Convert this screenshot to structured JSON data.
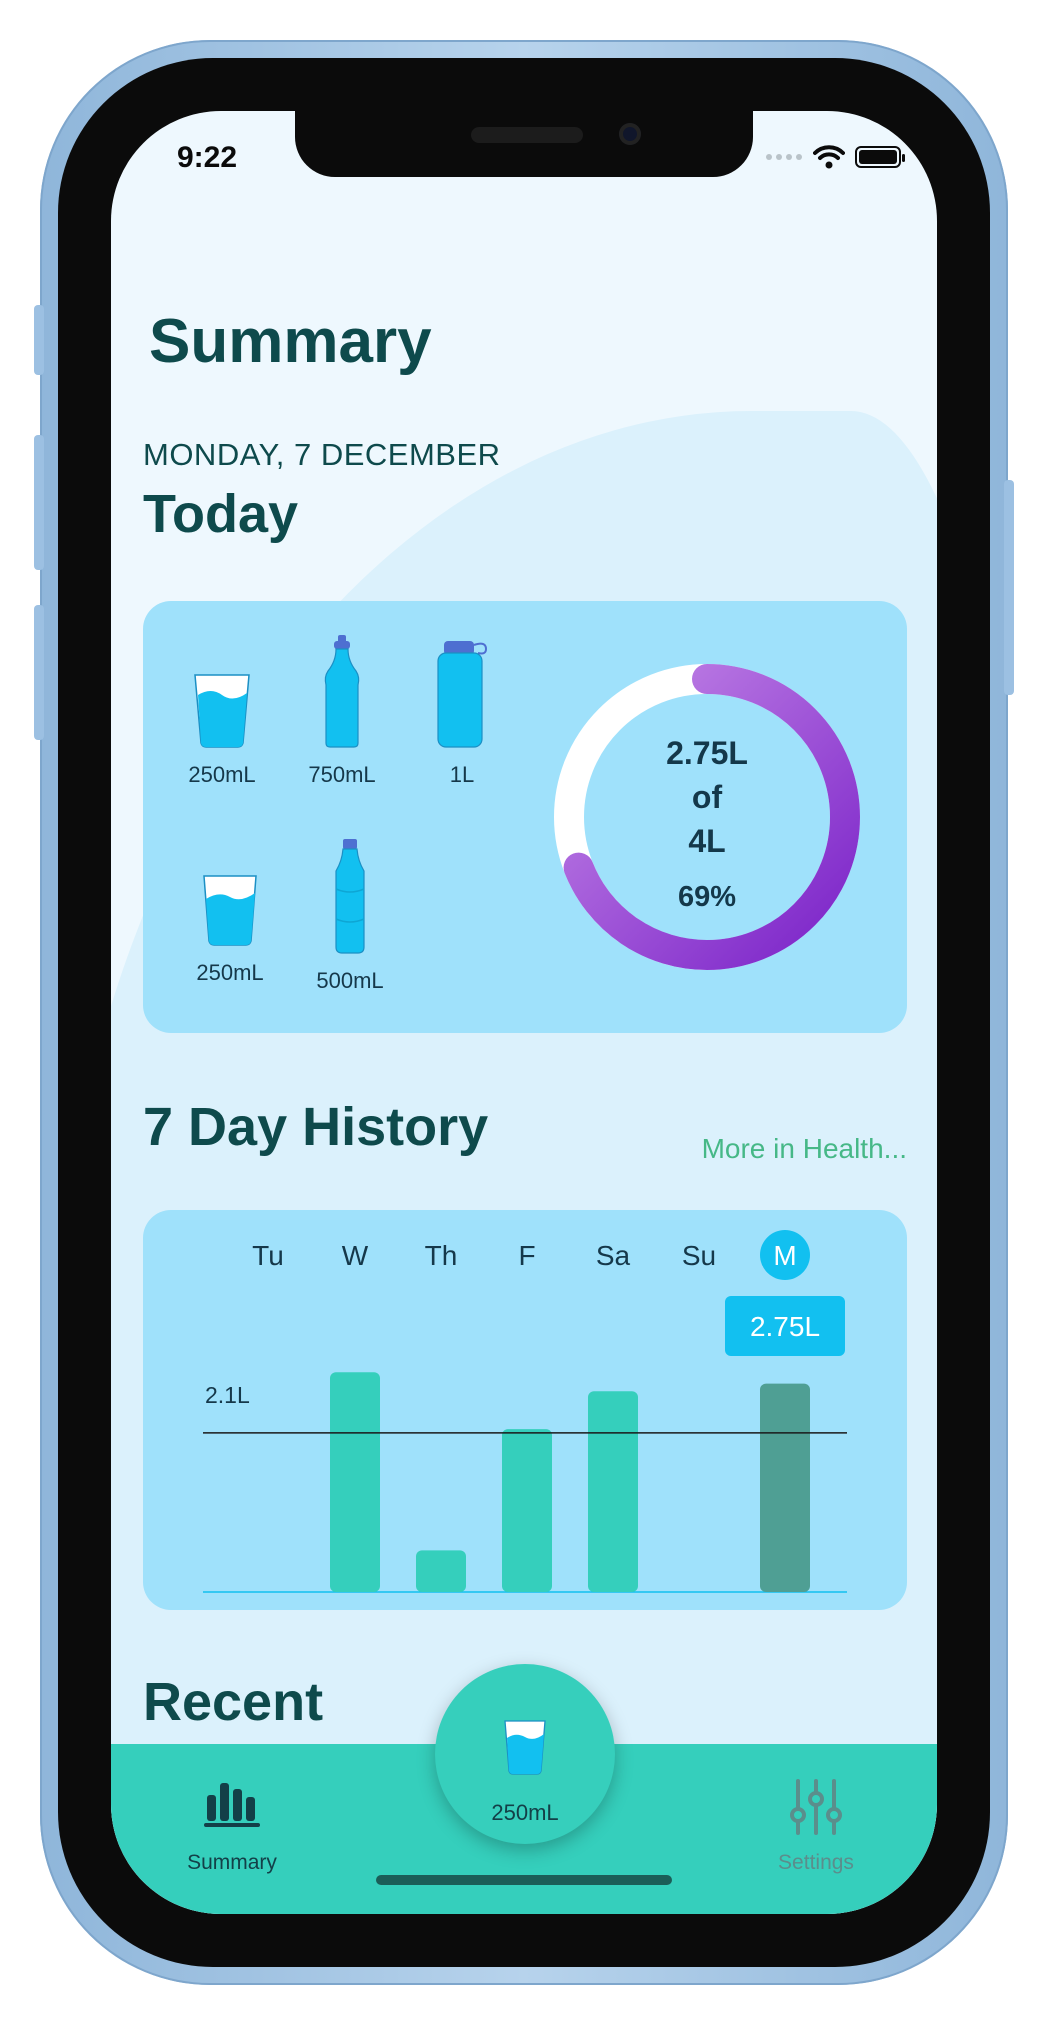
{
  "status": {
    "time": "9:22"
  },
  "page": {
    "title": "Summary",
    "date": "MONDAY, 7 DECEMBER",
    "today_heading": "Today"
  },
  "containers": [
    {
      "label": "250mL",
      "icon": "glass-icon"
    },
    {
      "label": "750mL",
      "icon": "sports-bottle-icon"
    },
    {
      "label": "1L",
      "icon": "flask-bottle-icon"
    },
    {
      "label": "250mL",
      "icon": "glass-icon"
    },
    {
      "label": "500mL",
      "icon": "water-bottle-icon"
    }
  ],
  "progress": {
    "amount": "2.75L",
    "of_word": "of",
    "goal": "4L",
    "percent": "69%",
    "fraction": 0.69
  },
  "history": {
    "title": "7 Day History",
    "more_link": "More in Health..."
  },
  "chart_data": {
    "type": "bar",
    "categories": [
      "Tu",
      "W",
      "Th",
      "F",
      "Sa",
      "Su",
      "M"
    ],
    "values": [
      0,
      2.9,
      0.55,
      2.15,
      2.65,
      0,
      2.75
    ],
    "selected_index": 6,
    "selected_value_label": "2.75L",
    "reference_line": {
      "value": 2.1,
      "label": "2.1L"
    },
    "ylim": [
      0,
      3.3
    ],
    "bar_color": "#35cfbc",
    "selected_bar_color": "#4f9f94",
    "accent_color": "#12c0f0"
  },
  "recent": {
    "title": "Recent"
  },
  "tabbar": {
    "summary_label": "Summary",
    "quick_add_label": "250mL",
    "settings_label": "Settings"
  }
}
